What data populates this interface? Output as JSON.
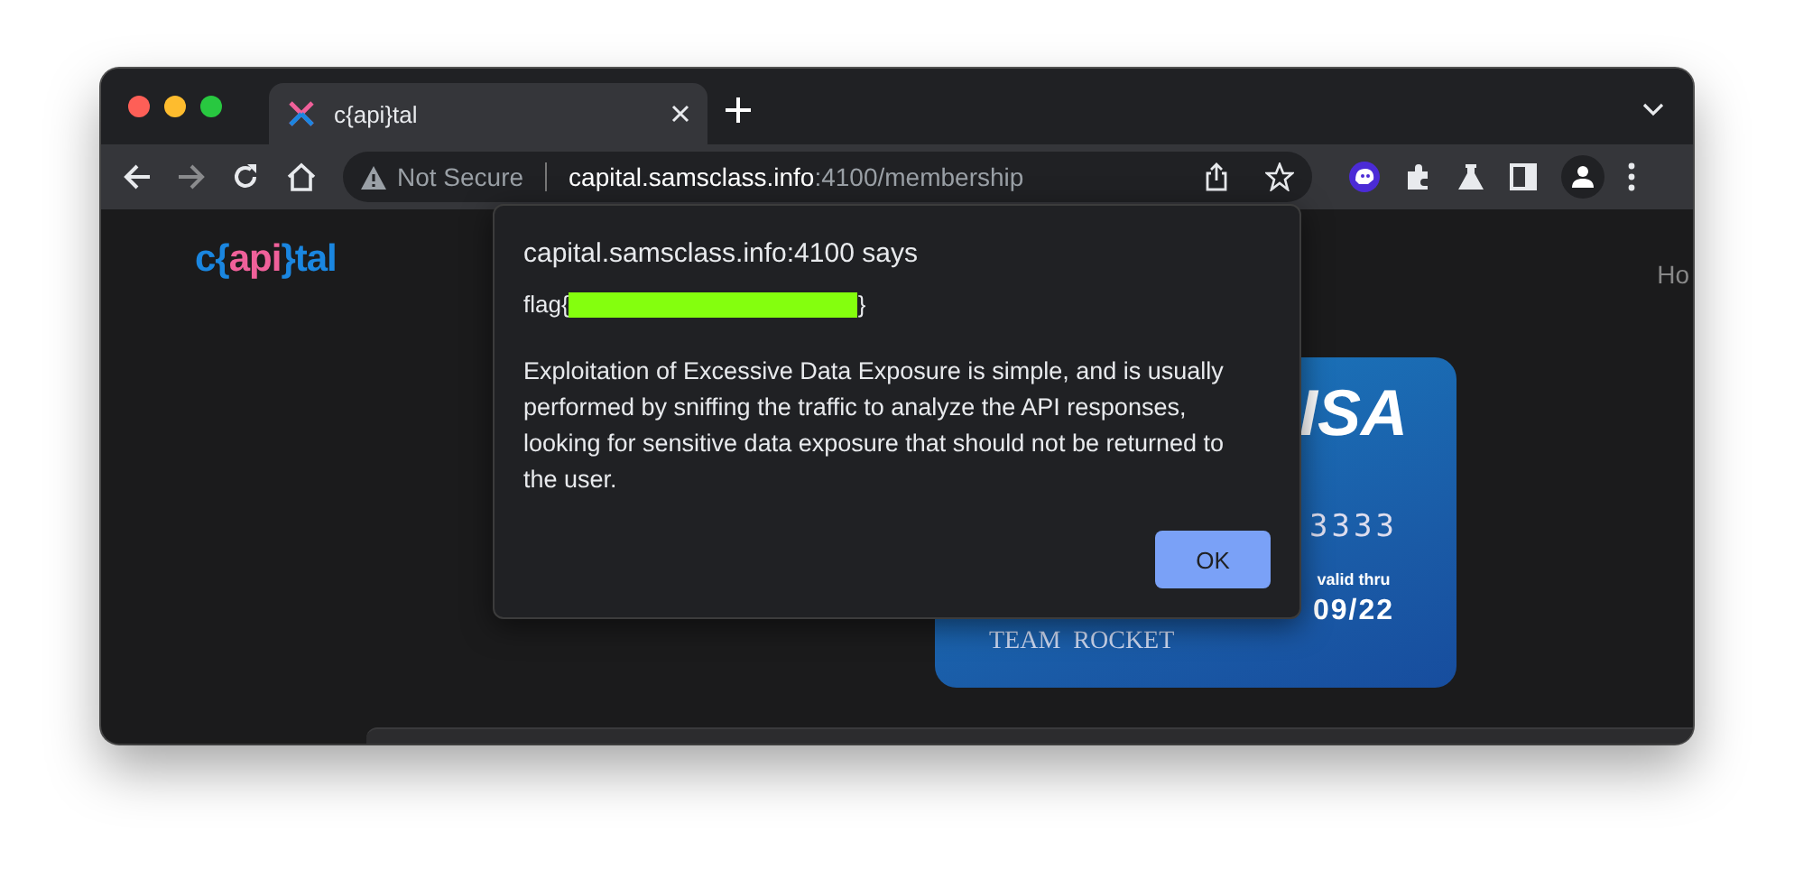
{
  "tabs": [
    {
      "title": "c{api}tal",
      "selected": true
    }
  ],
  "address_bar": {
    "security_label": "Not Secure",
    "url_host": "capital.samsclass.info",
    "url_path": ":4100/membership"
  },
  "page": {
    "logo": [
      {
        "text": "c{",
        "color": "#1a86e0"
      },
      {
        "text": "api",
        "color": "#f0609a"
      },
      {
        "text": "}tal",
        "color": "#1a86e0"
      }
    ],
    "nav_item": "Ho",
    "card": {
      "brand": "ISA",
      "number": "3333",
      "valid_label": "valid thru",
      "expiry": "09/22",
      "holder": "TEAM  ROCKET"
    }
  },
  "dialog": {
    "title": "capital.samsclass.info:4100 says",
    "flag_prefix": "flag{",
    "flag_suffix": "}",
    "message": "Exploitation of Excessive Data Exposure is simple, and is usually performed by sniffing the traffic to analyze the API responses, looking for sensitive data exposure that should not be returned to the user.",
    "button": "OK"
  }
}
